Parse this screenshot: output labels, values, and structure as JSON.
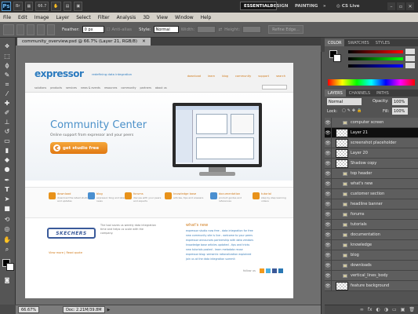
{
  "app": {
    "logo": "Ps",
    "zoom_dropdown": "66.7"
  },
  "workspaces": {
    "essentials": "ESSENTIALS",
    "design": "DESIGN",
    "painting": "PAINTING",
    "more": "»",
    "cslive": "CS Live"
  },
  "menu": [
    "File",
    "Edit",
    "Image",
    "Layer",
    "Select",
    "Filter",
    "Analysis",
    "3D",
    "View",
    "Window",
    "Help"
  ],
  "options": {
    "feather_label": "Feather:",
    "feather_value": "0 px",
    "antialias_label": "Anti-alias",
    "style_label": "Style:",
    "style_value": "Normal",
    "width_label": "Width:",
    "height_label": "Height:",
    "refine_edge": "Refine Edge..."
  },
  "document": {
    "tab_title": "community_overview.psd @ 66.7% (Layer 21, RGB/8)"
  },
  "status": {
    "zoom": "66.67%",
    "doc": "Doc: 2.21M/39.8M"
  },
  "panels": {
    "color_tabs": [
      "COLOR",
      "SWATCHES",
      "STYLES"
    ],
    "layer_tabs": [
      "LAYERS",
      "CHANNELS",
      "PATHS"
    ],
    "blend_mode": "Normal",
    "opacity_label": "Opacity:",
    "opacity_value": "100%",
    "lock_label": "Lock:",
    "fill_label": "Fill:",
    "fill_value": "100%"
  },
  "layers": [
    {
      "name": "computer screen",
      "kind": "folder",
      "selected": false
    },
    {
      "name": "Layer 21",
      "kind": "layer",
      "selected": true
    },
    {
      "name": "screenshot placeholder",
      "kind": "layer",
      "selected": false
    },
    {
      "name": "Layer 20",
      "kind": "layer",
      "selected": false
    },
    {
      "name": "Shadow copy",
      "kind": "layer",
      "selected": false
    },
    {
      "name": "top header",
      "kind": "folder",
      "selected": false
    },
    {
      "name": "what's new",
      "kind": "folder",
      "selected": false
    },
    {
      "name": "customer section",
      "kind": "folder",
      "selected": false
    },
    {
      "name": "headline banner",
      "kind": "folder",
      "selected": false
    },
    {
      "name": "forums",
      "kind": "folder",
      "selected": false
    },
    {
      "name": "tutorials",
      "kind": "folder",
      "selected": false
    },
    {
      "name": "documentation",
      "kind": "folder",
      "selected": false
    },
    {
      "name": "knowledge",
      "kind": "folder",
      "selected": false
    },
    {
      "name": "blog",
      "kind": "folder",
      "selected": false
    },
    {
      "name": "downloads",
      "kind": "folder",
      "selected": false
    },
    {
      "name": "vertical_lines_body",
      "kind": "folder",
      "selected": false
    },
    {
      "name": "feature background",
      "kind": "layer",
      "selected": false
    }
  ],
  "webpage": {
    "logo": "expressor",
    "tagline": "redefining data integration",
    "nav": [
      "download",
      "learn",
      "blog",
      "community",
      "support",
      "search"
    ],
    "subnav": [
      "solutions",
      "products",
      "services",
      "news & events",
      "resources",
      "community",
      "partners",
      "about us"
    ],
    "hero_title": "Community Center",
    "hero_sub": "Online support from expressor and your peers",
    "cta": "get studio free",
    "services": [
      {
        "title": "download",
        "desc": "download the latest studio and updates",
        "color": "#e8921a"
      },
      {
        "title": "blog",
        "desc": "expressor blog and latest news",
        "color": "#4a8fd0"
      },
      {
        "title": "forums",
        "desc": "discuss with your peers and experts",
        "color": "#e8921a"
      },
      {
        "title": "knowledge base",
        "desc": "articles, tips and answers",
        "color": "#e8921a"
      },
      {
        "title": "documentation",
        "desc": "product guides and references",
        "color": "#4a8fd0"
      },
      {
        "title": "tutorial",
        "desc": "step by step learning videos",
        "color": "#e8921a"
      }
    ],
    "customer_logo": "SKECHERS",
    "quote": "The tool saves us weekly data integration time and helps us scale with the company.",
    "customer_links": "View more  |  Read quote",
    "whats_new_title": "what's new",
    "news": [
      "expressor studio now free - data integration for free",
      "new community site is live - welcome to your peers",
      "expressor announces partnership with data vendors",
      "knowledge base articles updated - tips and tricks",
      "new tutorials posted - learn metadata reuse",
      "expressor blog: semantic rationalization explained",
      "join us at the data integration summit"
    ],
    "follow": "follow us"
  }
}
